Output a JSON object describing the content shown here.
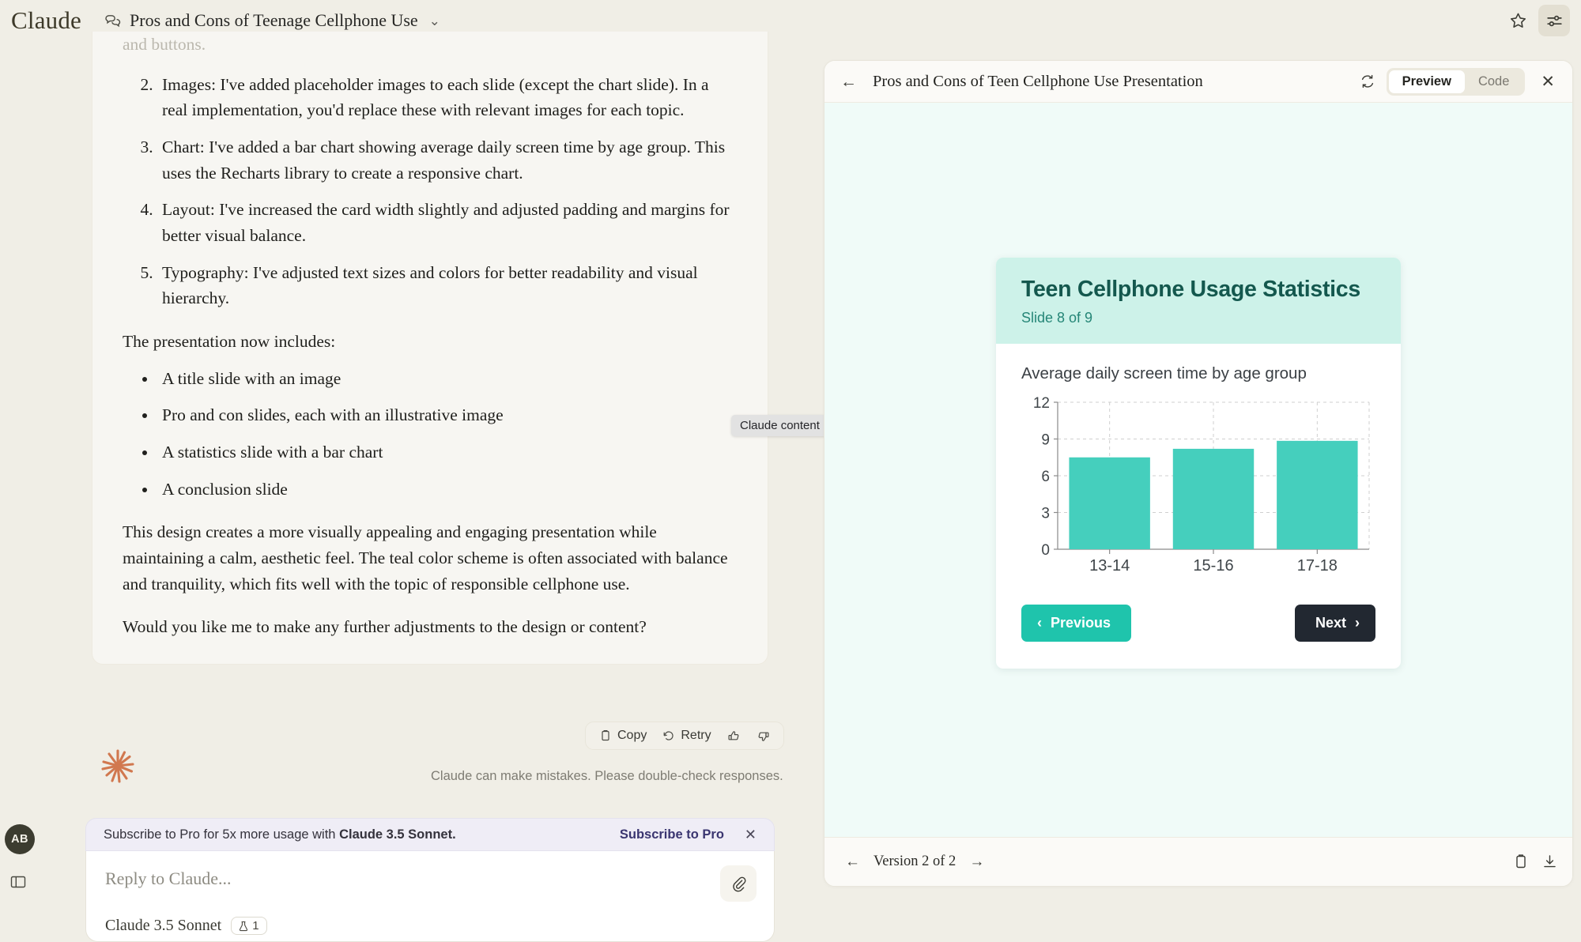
{
  "topbar": {
    "brand": "Claude",
    "conversation_title": "Pros and Cons of Teenage Cellphone Use",
    "chevron": "⌄",
    "star_icon": "star-icon",
    "settings_icon": "sliders-icon"
  },
  "message": {
    "truncated_line": "and buttons.",
    "numbered_items": [
      {
        "num": "2.",
        "text": "Images: I've added placeholder images to each slide (except the chart slide). In a real implementation, you'd replace these with relevant images for each topic."
      },
      {
        "num": "3.",
        "text": "Chart: I've added a bar chart showing average daily screen time by age group. This uses the Recharts library to create a responsive chart."
      },
      {
        "num": "4.",
        "text": "Layout: I've increased the card width slightly and adjusted padding and margins for better visual balance."
      },
      {
        "num": "5.",
        "text": "Typography: I've adjusted text sizes and colors for better readability and visual hierarchy."
      }
    ],
    "includes_intro": "The presentation now includes:",
    "bullets": [
      "A title slide with an image",
      "Pro and con slides, each with an illustrative image",
      "A statistics slide with a bar chart",
      "A conclusion slide"
    ],
    "paragraph_1": "This design creates a more visually appealing and engaging presentation while maintaining a calm, aesthetic feel. The teal color scheme is often associated with balance and tranquility, which fits well with the topic of responsible cellphone use.",
    "paragraph_2": "Would you like me to make any further adjustments to the design or content?",
    "actions": {
      "copy": "Copy",
      "retry": "Retry",
      "thumbs_up": "thumbs-up-icon",
      "thumbs_down": "thumbs-down-icon"
    },
    "disclaimer": "Claude can make mistakes. Please double-check responses."
  },
  "tooltip": {
    "text": "Claude content"
  },
  "subscribe_banner": {
    "text_prefix": "Subscribe to Pro for 5x more usage with ",
    "text_bold": "Claude 3.5 Sonnet.",
    "cta": "Subscribe to Pro",
    "close": "✕"
  },
  "composer": {
    "placeholder": "Reply to Claude...",
    "model": "Claude 3.5 Sonnet",
    "beaker_count": "1",
    "attach_icon": "paperclip-icon"
  },
  "user": {
    "initials": "AB"
  },
  "sidebar_toggle": {
    "icon": "panel-toggle-icon"
  },
  "artifact": {
    "back_icon": "←",
    "title": "Pros and Cons of Teen Cellphone Use Presentation",
    "refresh_icon": "refresh-icon",
    "tabs": [
      {
        "label": "Preview",
        "selected": true
      },
      {
        "label": "Code",
        "selected": false
      }
    ],
    "close_icon": "✕",
    "footer": {
      "prev_icon": "←",
      "version_label": "Version 2 of 2",
      "next_icon": "→",
      "copy_icon": "clipboard-icon",
      "download_icon": "download-icon"
    }
  },
  "slide": {
    "title": "Teen Cellphone Usage Statistics",
    "subtitle": "Slide 8 of 9",
    "prev_button": "Previous",
    "next_button": "Next",
    "prev_chevron": "‹",
    "next_chevron": "›",
    "colors": {
      "header_bg": "#CDF2E9",
      "title": "#14584E",
      "bar": "#45CFBD",
      "prev_btn": "#1FC4AC",
      "next_btn": "#222831",
      "canvas_bg": "#F0FBF8"
    }
  },
  "chart_data": {
    "type": "bar",
    "title": "Average daily screen time by age group",
    "categories": [
      "13-14",
      "15-16",
      "17-18"
    ],
    "values": [
      7.5,
      8.2,
      8.85
    ],
    "xlabel": "",
    "ylabel": "",
    "ylim": [
      0,
      12
    ],
    "yticks": [
      0,
      3,
      6,
      9,
      12
    ],
    "grid": true,
    "legend": false,
    "bar_color": "#45CFBD"
  }
}
